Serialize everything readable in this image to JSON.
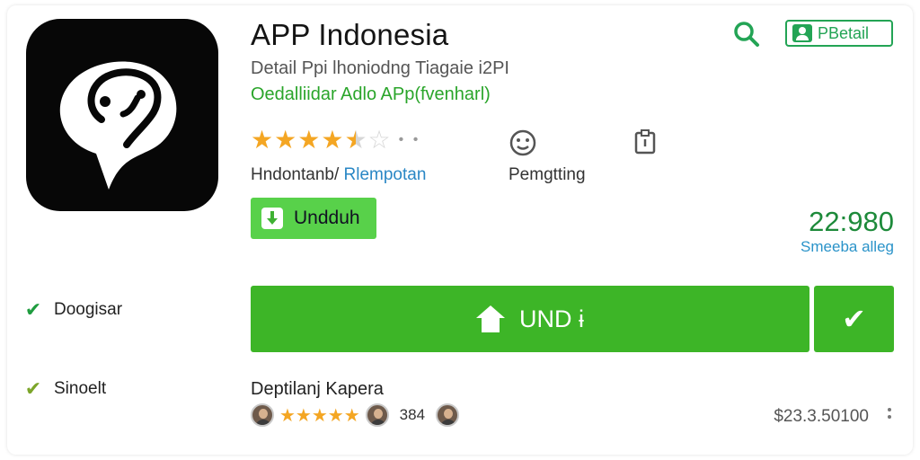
{
  "app": {
    "title": "APP Indonesia",
    "subtitle": "Detail Ppi lhoniodng Tiagaie i2PI",
    "developer": "Oedalliidar Adlo APp(fvenharl)"
  },
  "header": {
    "search_icon": "search-icon",
    "detail_label": "PBetail"
  },
  "rating": {
    "value": 4.5,
    "max": 5,
    "extra": "• •",
    "caption_left": "Hndontanb/ ",
    "caption_right": "Rlempotan"
  },
  "meta": {
    "icon1": "smiley-icon",
    "icon2": "tag-icon",
    "caption": "Pemgtting"
  },
  "small_download": {
    "label": "Undduh"
  },
  "downloads": {
    "count": "22:980",
    "caption": "Smeeba alleg"
  },
  "side": {
    "items": [
      {
        "label": "Doogisar"
      },
      {
        "label": "Sinoelt"
      }
    ]
  },
  "big_download": {
    "label": "UND ɨ"
  },
  "reviews": {
    "title": "Deptilanj Kapera",
    "count": "384",
    "stars": "★★★★★",
    "price": "$23.3.50100"
  },
  "colors": {
    "accent_green": "#3db527",
    "developer_green": "#2aa52a",
    "star": "#f4a623"
  }
}
